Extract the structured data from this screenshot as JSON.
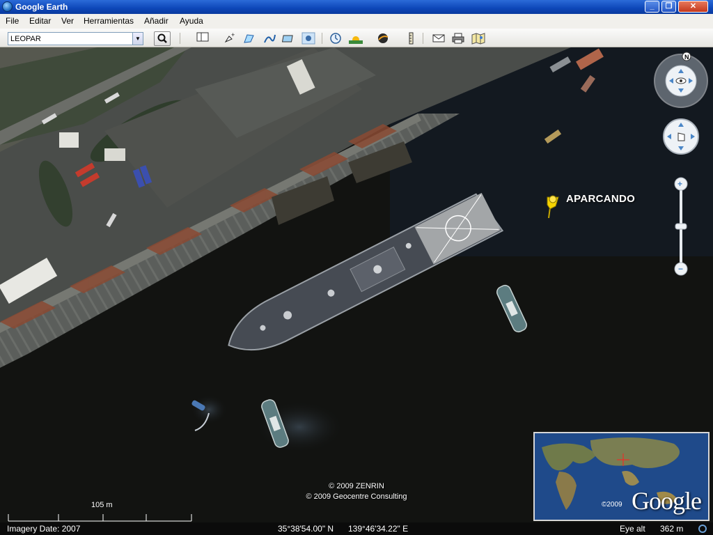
{
  "window": {
    "title": "Google Earth"
  },
  "menu": [
    "File",
    "Editar",
    "Ver",
    "Herramientas",
    "Añadir",
    "Ayuda"
  ],
  "search": {
    "value": "LEOPAR"
  },
  "placemark": {
    "label": "APARCANDO"
  },
  "credits": {
    "line1": "© 2009 ZENRIN",
    "line2": "© 2009 Geocentre Consulting"
  },
  "overview": {
    "copyright": "©2009",
    "logo": "Google"
  },
  "scale": {
    "label": "105 m"
  },
  "status": {
    "imagery_date": "Imagery Date: 2007",
    "lat": "35°38'54.00\" N",
    "lon": "139°46'34.22\" E",
    "eye_alt_label": "Eye alt",
    "eye_alt_value": "362 m"
  },
  "colors": {
    "titlebar": "#0d46b8",
    "placemark_pin": "#f5d300",
    "water": "#10110f"
  }
}
